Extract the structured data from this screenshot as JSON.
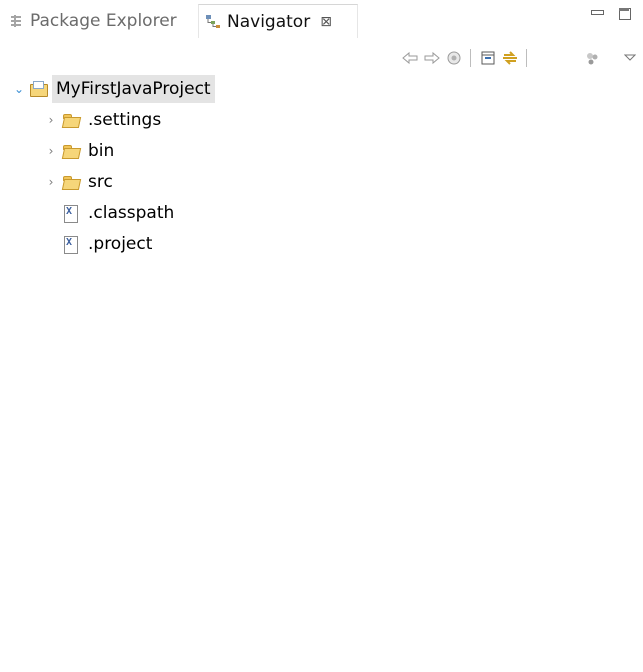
{
  "tabs": [
    {
      "label": "Package Explorer",
      "icon": "package-explorer-icon",
      "active": false
    },
    {
      "label": "Navigator",
      "icon": "navigator-icon",
      "active": true,
      "close_glyph": "⊠"
    }
  ],
  "toolbar": {
    "back_icon": "back-arrow-icon",
    "forward_icon": "forward-arrow-icon",
    "up_icon": "go-into-icon",
    "collapse_icon": "collapse-all-icon",
    "link_icon": "link-with-editor-icon",
    "filter_icon": "filters-icon",
    "menu_icon": "view-menu-chevron-icon"
  },
  "tree": {
    "project": {
      "label": "MyFirstJavaProject",
      "expanded": true
    },
    "children": [
      {
        "label": ".settings",
        "kind": "folder"
      },
      {
        "label": "bin",
        "kind": "folder"
      },
      {
        "label": "src",
        "kind": "folder"
      },
      {
        "label": ".classpath",
        "kind": "file"
      },
      {
        "label": ".project",
        "kind": "file"
      }
    ]
  },
  "colors": {
    "selection": "#e4e4e4",
    "expand_arrow": "#3a8fd4",
    "folder": "#f6d67a"
  }
}
